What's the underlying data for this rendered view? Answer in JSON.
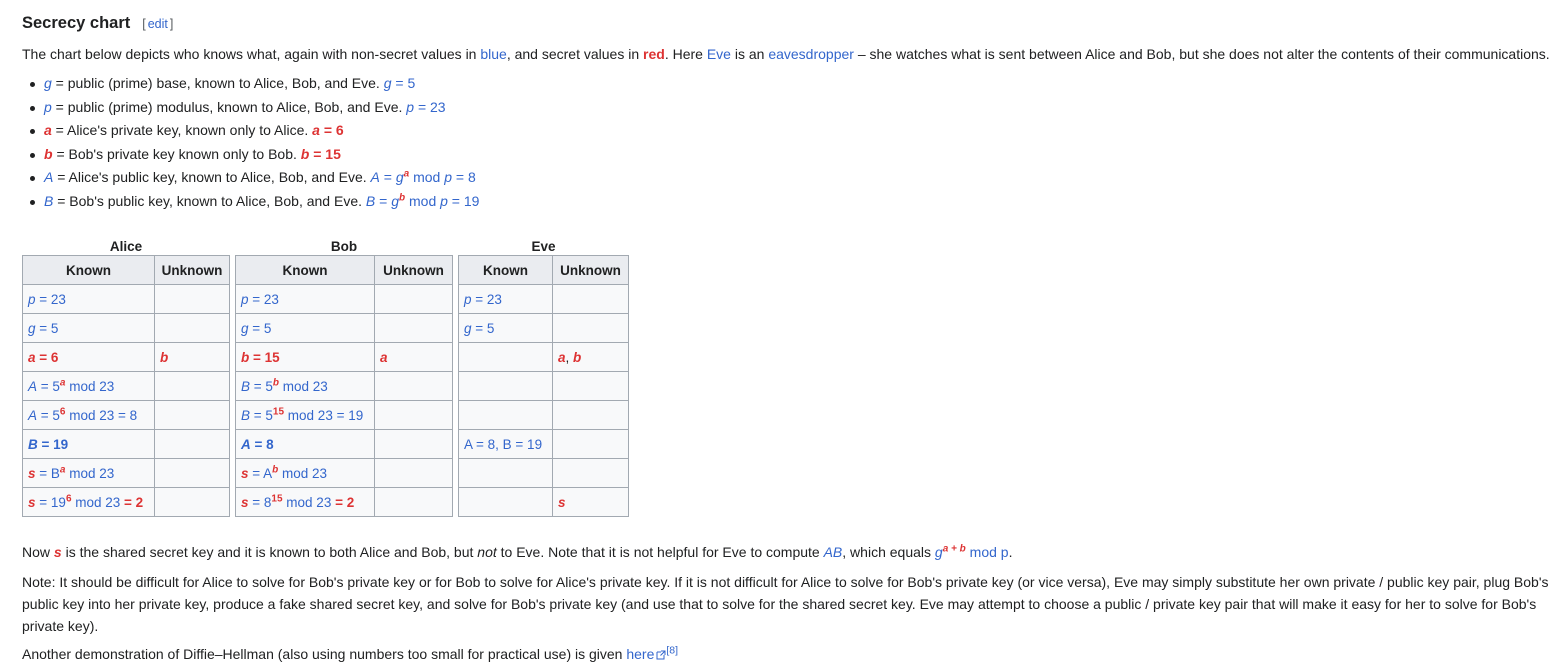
{
  "section": {
    "title": "Secrecy chart",
    "edit_label": "edit",
    "edit_open": "[",
    "edit_close": "]"
  },
  "intro": {
    "t1": "The chart below depicts who knows what, again with non-secret values in ",
    "blue": "blue",
    "t2": ", and secret values in ",
    "red": "red",
    "t3": ". Here ",
    "eve_link": "Eve",
    "t4": " is an ",
    "eaves_link": "eavesdropper",
    "t5": " – she watches what is sent between Alice and Bob, but she does not alter the contents of their communications."
  },
  "bullets": [
    {
      "sym": "g",
      "desc": " = public (prime) base, known to Alice, Bob, and Eve. ",
      "expr": "g",
      "val": " = 5"
    },
    {
      "sym": "p",
      "desc": " = public (prime) modulus, known to Alice, Bob, and Eve. ",
      "expr": "p",
      "val": " = 23"
    },
    {
      "sym": "a",
      "desc": " = Alice's private key, known only to Alice. ",
      "expr": "a",
      "val": " = 6"
    },
    {
      "sym": "b",
      "desc": " = Bob's private key known only to Bob. ",
      "expr": "b",
      "val": " = 15"
    },
    {
      "sym": "A",
      "desc": " = Alice's public key, known to Alice, Bob, and Eve. ",
      "e1": "A",
      "e2": " = ",
      "e3": "g",
      "sup": "a",
      "e4": " mod ",
      "e5": "p",
      "val": " = 8"
    },
    {
      "sym": "B",
      "desc": " = Bob's public key, known to Alice, Bob, and Eve. ",
      "e1": "B",
      "e2": " = ",
      "e3": "g",
      "sup": "b",
      "e4": " mod ",
      "e5": "p",
      "val": " = 19"
    }
  ],
  "tables": {
    "alice": {
      "caption": "Alice",
      "known": "Known",
      "unknown": "Unknown"
    },
    "bob": {
      "caption": "Bob",
      "known": "Known",
      "unknown": "Unknown"
    },
    "eve": {
      "caption": "Eve",
      "known": "Known",
      "unknown": "Unknown"
    }
  },
  "cells": {
    "p": "p",
    "g": "g",
    "a": "a",
    "b": "b",
    "A": "A",
    "B": "B",
    "s": "s",
    "eq23": " = 23",
    "eq5": " = 5",
    "eq6": " = 6",
    "eq15": " = 15",
    "eq8": " = 8",
    "eq19": " = 19",
    "eq": " = ",
    "five": "5",
    "mod23": " mod 23",
    "mod23eq8": " mod 23 = 8",
    "mod23eq19": " mod 23 = 19",
    "sup6": "6",
    "sup15": "15",
    "nineteen": "19",
    "eight": "8",
    "mod23eq2": " mod 23 = 2",
    "eve_ab_sep": ", ",
    "eve_known_A": "A = 8",
    "eve_known_sep": ", ",
    "eve_known_B": "B = 19"
  },
  "after": {
    "p1_t1": "Now ",
    "p1_s": "s",
    "p1_t2": " is the shared secret key and it is known to both Alice and Bob, but ",
    "p1_not": "not",
    "p1_t3": " to Eve. Note that it is not helpful for Eve to compute ",
    "p1_AB": "AB",
    "p1_t4": ", which equals ",
    "p1_g": "g",
    "p1_sup": "a + b",
    "p1_t5": " mod ",
    "p1_p": "p",
    "p1_t6": ".",
    "p2": "Note: It should be difficult for Alice to solve for Bob's private key or for Bob to solve for Alice's private key. If it is not difficult for Alice to solve for Bob's private key (or vice versa), Eve may simply substitute her own private / public key pair, plug Bob's public key into her private key, produce a fake shared secret key, and solve for Bob's private key (and use that to solve for the shared secret key. Eve may attempt to choose a public / private key pair that will make it easy for her to solve for Bob's private key).",
    "p3_t1": "Another demonstration of Diffie–Hellman (also using numbers too small for practical use) is given ",
    "p3_link": "here",
    "p3_ref": "[8]"
  },
  "colors": {
    "public": "#3366cc",
    "secret": "#dd3333",
    "header_bg": "#eaecf0",
    "table_bg": "#f8f9fa",
    "border": "#a2a9b1"
  },
  "icons": {
    "external_link": "external-link-icon"
  }
}
